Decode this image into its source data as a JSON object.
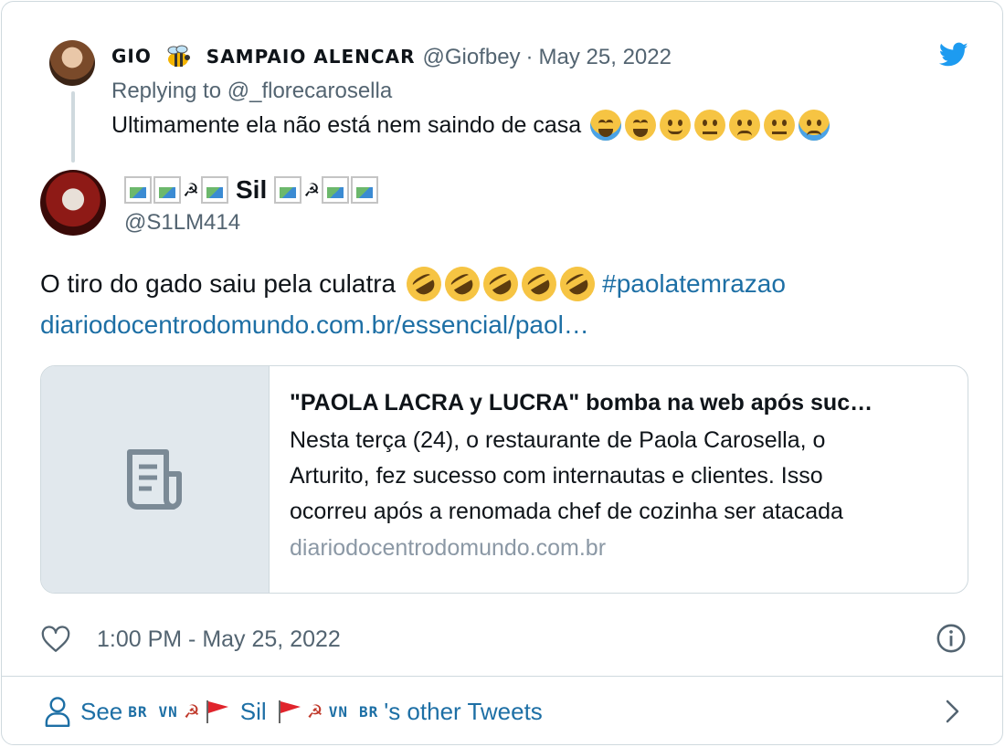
{
  "parent_tweet": {
    "name_part1": "GIO",
    "name_part2": "SAMPAIO ALENCAR",
    "handle": "@Giofbey",
    "separator": "·",
    "date": "May 25, 2022",
    "replying_prefix": "Replying to",
    "replying_to": "@_florecarosella",
    "text": "Ultimamente ela não está nem saindo de casa",
    "emojis": [
      "face-with-tears-of-joy",
      "grinning-face",
      "slightly-smiling-face",
      "confused-face",
      "frowning-face",
      "face-with-rolling-eyes",
      "loudly-crying-face"
    ]
  },
  "main_tweet": {
    "display_name": "Sil",
    "handle": "@S1LM414",
    "text": "O tiro do gado saiu pela culatra",
    "emoji_count": 5,
    "emoji": "rolling-on-the-floor-laughing",
    "hashtag": "#paolatemrazao",
    "link": "diariodocentrodomundo.com.br/essencial/paol…",
    "timestamp": "1:00 PM - May 25, 2022"
  },
  "preview": {
    "title": "\"PAOLA LACRA y LUCRA\" bomba na web após suc…",
    "description_lines": [
      "Nesta terça (24), o restaurante de Paola Carosella, o",
      "Arturito, fez sucesso com internautas e clientes.  Isso",
      "ocorreu após a renomada chef de cozinha ser atacada"
    ],
    "domain": "diariodocentrodomundo.com.br"
  },
  "footer": {
    "see_prefix": "See",
    "flag_label_br": "BR",
    "flag_label_vn": "VN",
    "name": "Sil",
    "suffix": "'s other Tweets"
  },
  "colors": {
    "link": "#1d6fa5",
    "muted": "#536471",
    "twitter_blue": "#1d9bf0",
    "border": "#cfd9de"
  }
}
